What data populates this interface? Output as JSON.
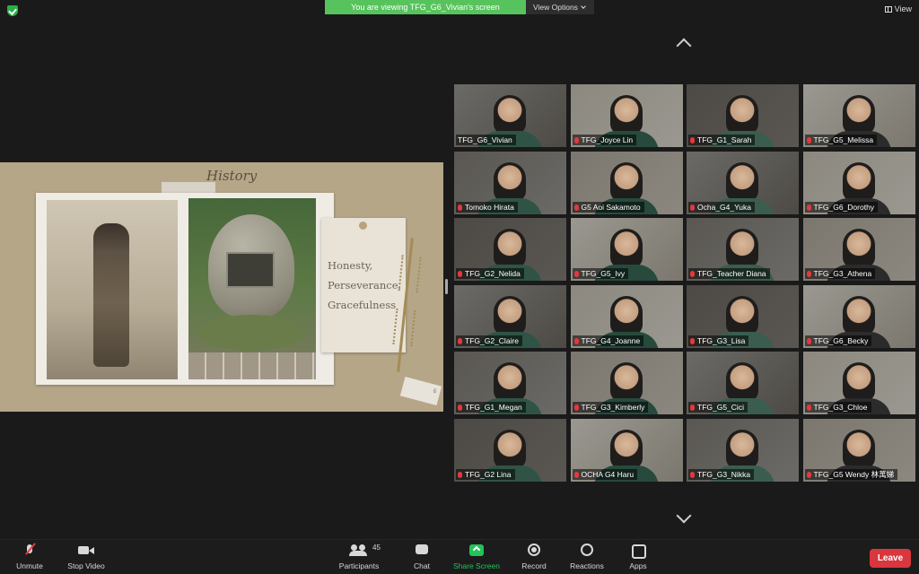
{
  "banner": {
    "viewing_text": "You are viewing TFG_G6_Vivian's screen",
    "view_options": "View Options"
  },
  "top_right": {
    "view_label": "View"
  },
  "slide": {
    "title": "History",
    "note_lines": [
      "Honesty,",
      "Perseverance,",
      "Gracefulness"
    ],
    "page_number": "6"
  },
  "gallery": {
    "participants": [
      "TFG_G6_Vivian",
      "TFG_Joyce Lin",
      "TFG_G1_Sarah",
      "TFG_G5_Melissa",
      "Tomoko Hirata",
      "G5 Aoi Sakamoto",
      "Ocha_G4_Yuka",
      "TFG_G6_Dorothy",
      "TFG_G2_Nelida",
      "TFG_G5_Ivy",
      "TFG_Teacher Diana",
      "TFG_G3_Athena",
      "TFG_G2_Claire",
      "TFG_G4_Joanne",
      "TFG_G3_Lisa",
      "TFG_G6_Becky",
      "TFG_G1_Megan",
      "TFG_G3_Kimberly",
      "TFG_G5_Cici",
      "TFG_G3_Chloe",
      "TFG_G2 Lina",
      "OCHA G4 Haru",
      "TFG_G3_Nikka",
      "TFG_G5 Wendy 林萬娣"
    ],
    "active_speaker": "TFG_G6_Vivian"
  },
  "toolbar": {
    "unmute": "Unmute",
    "stop_video": "Stop Video",
    "participants": "Participants",
    "participants_count": "45",
    "chat": "Chat",
    "share_screen": "Share Screen",
    "record": "Record",
    "reactions": "Reactions",
    "apps": "Apps",
    "leave": "Leave"
  },
  "colors": {
    "banner_green": "#56c35c",
    "share_green": "#23c35a",
    "leave_red": "#d9363e",
    "muted_red": "#e0393e"
  }
}
